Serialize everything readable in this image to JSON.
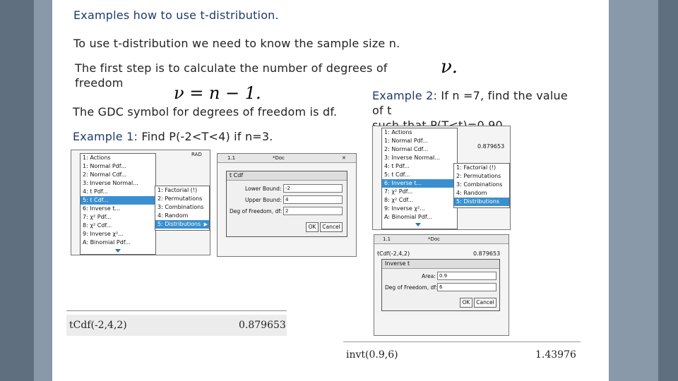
{
  "heading": "Examples how to use t-distribution.",
  "intro": "To use t-distribution we need to know the sample size n.",
  "step_line1": "The first step is to calculate the number of degrees of",
  "step_line2": "freedom",
  "nu_symbol": "ν.",
  "nu_formula": "ν = n − 1.",
  "gdc_text": "The GDC symbol for degrees of freedom is df.",
  "example1": {
    "label": "Example 1:",
    "text": "Find P(-2<T<4) if n=3."
  },
  "example2": {
    "label": "Example 2:",
    "line1": "If n =7, find the value",
    "line2": "of t",
    "line3": "such that P(T<t)=0.90."
  },
  "menu_main": [
    "1: Actions",
    "1: Normal Pdf...",
    "2: Normal Cdf...",
    "3: Inverse Normal...",
    "4: t Pdf...",
    "5: t Cdf...",
    "6: Inverse t...",
    "7: χ² Pdf...",
    "8: χ² Cdf...",
    "9: Inverse χ²...",
    "A: Binomial Pdf..."
  ],
  "menu_sub": [
    "1: Factorial (!)",
    "2: Permutations",
    "3: Combinations",
    "4: Random",
    "5: Distributions"
  ],
  "calc1": {
    "tab": "1.1",
    "doc": "*Doc",
    "rad": "RAD"
  },
  "tcdf_dialog": {
    "title": "t Cdf",
    "lower_label": "Lower Bound:",
    "lower_value": "-2",
    "upper_label": "Upper Bound:",
    "upper_value": "4",
    "df_label": "Deg of Freedom, df:",
    "df_value": "2",
    "ok": "OK",
    "cancel": "Cancel"
  },
  "result1": {
    "expr": "tCdf(-2,4,2)",
    "value": "0.879653"
  },
  "calc2": {
    "result_value": "0.879653"
  },
  "invt_dialog": {
    "title": "Inverse t",
    "area_label": "Area:",
    "area_value": "0.9",
    "df_label": "Deg of Freedom, df:",
    "df_value": "6",
    "ok": "OK",
    "cancel": "Cancel"
  },
  "calc3": {
    "tab": "1.1",
    "doc": "*Doc",
    "expr": "tCdf(-2,4,2)",
    "value": "0.879653"
  },
  "result2": {
    "expr": "invt(0.9,6)",
    "value": "1.43976"
  }
}
